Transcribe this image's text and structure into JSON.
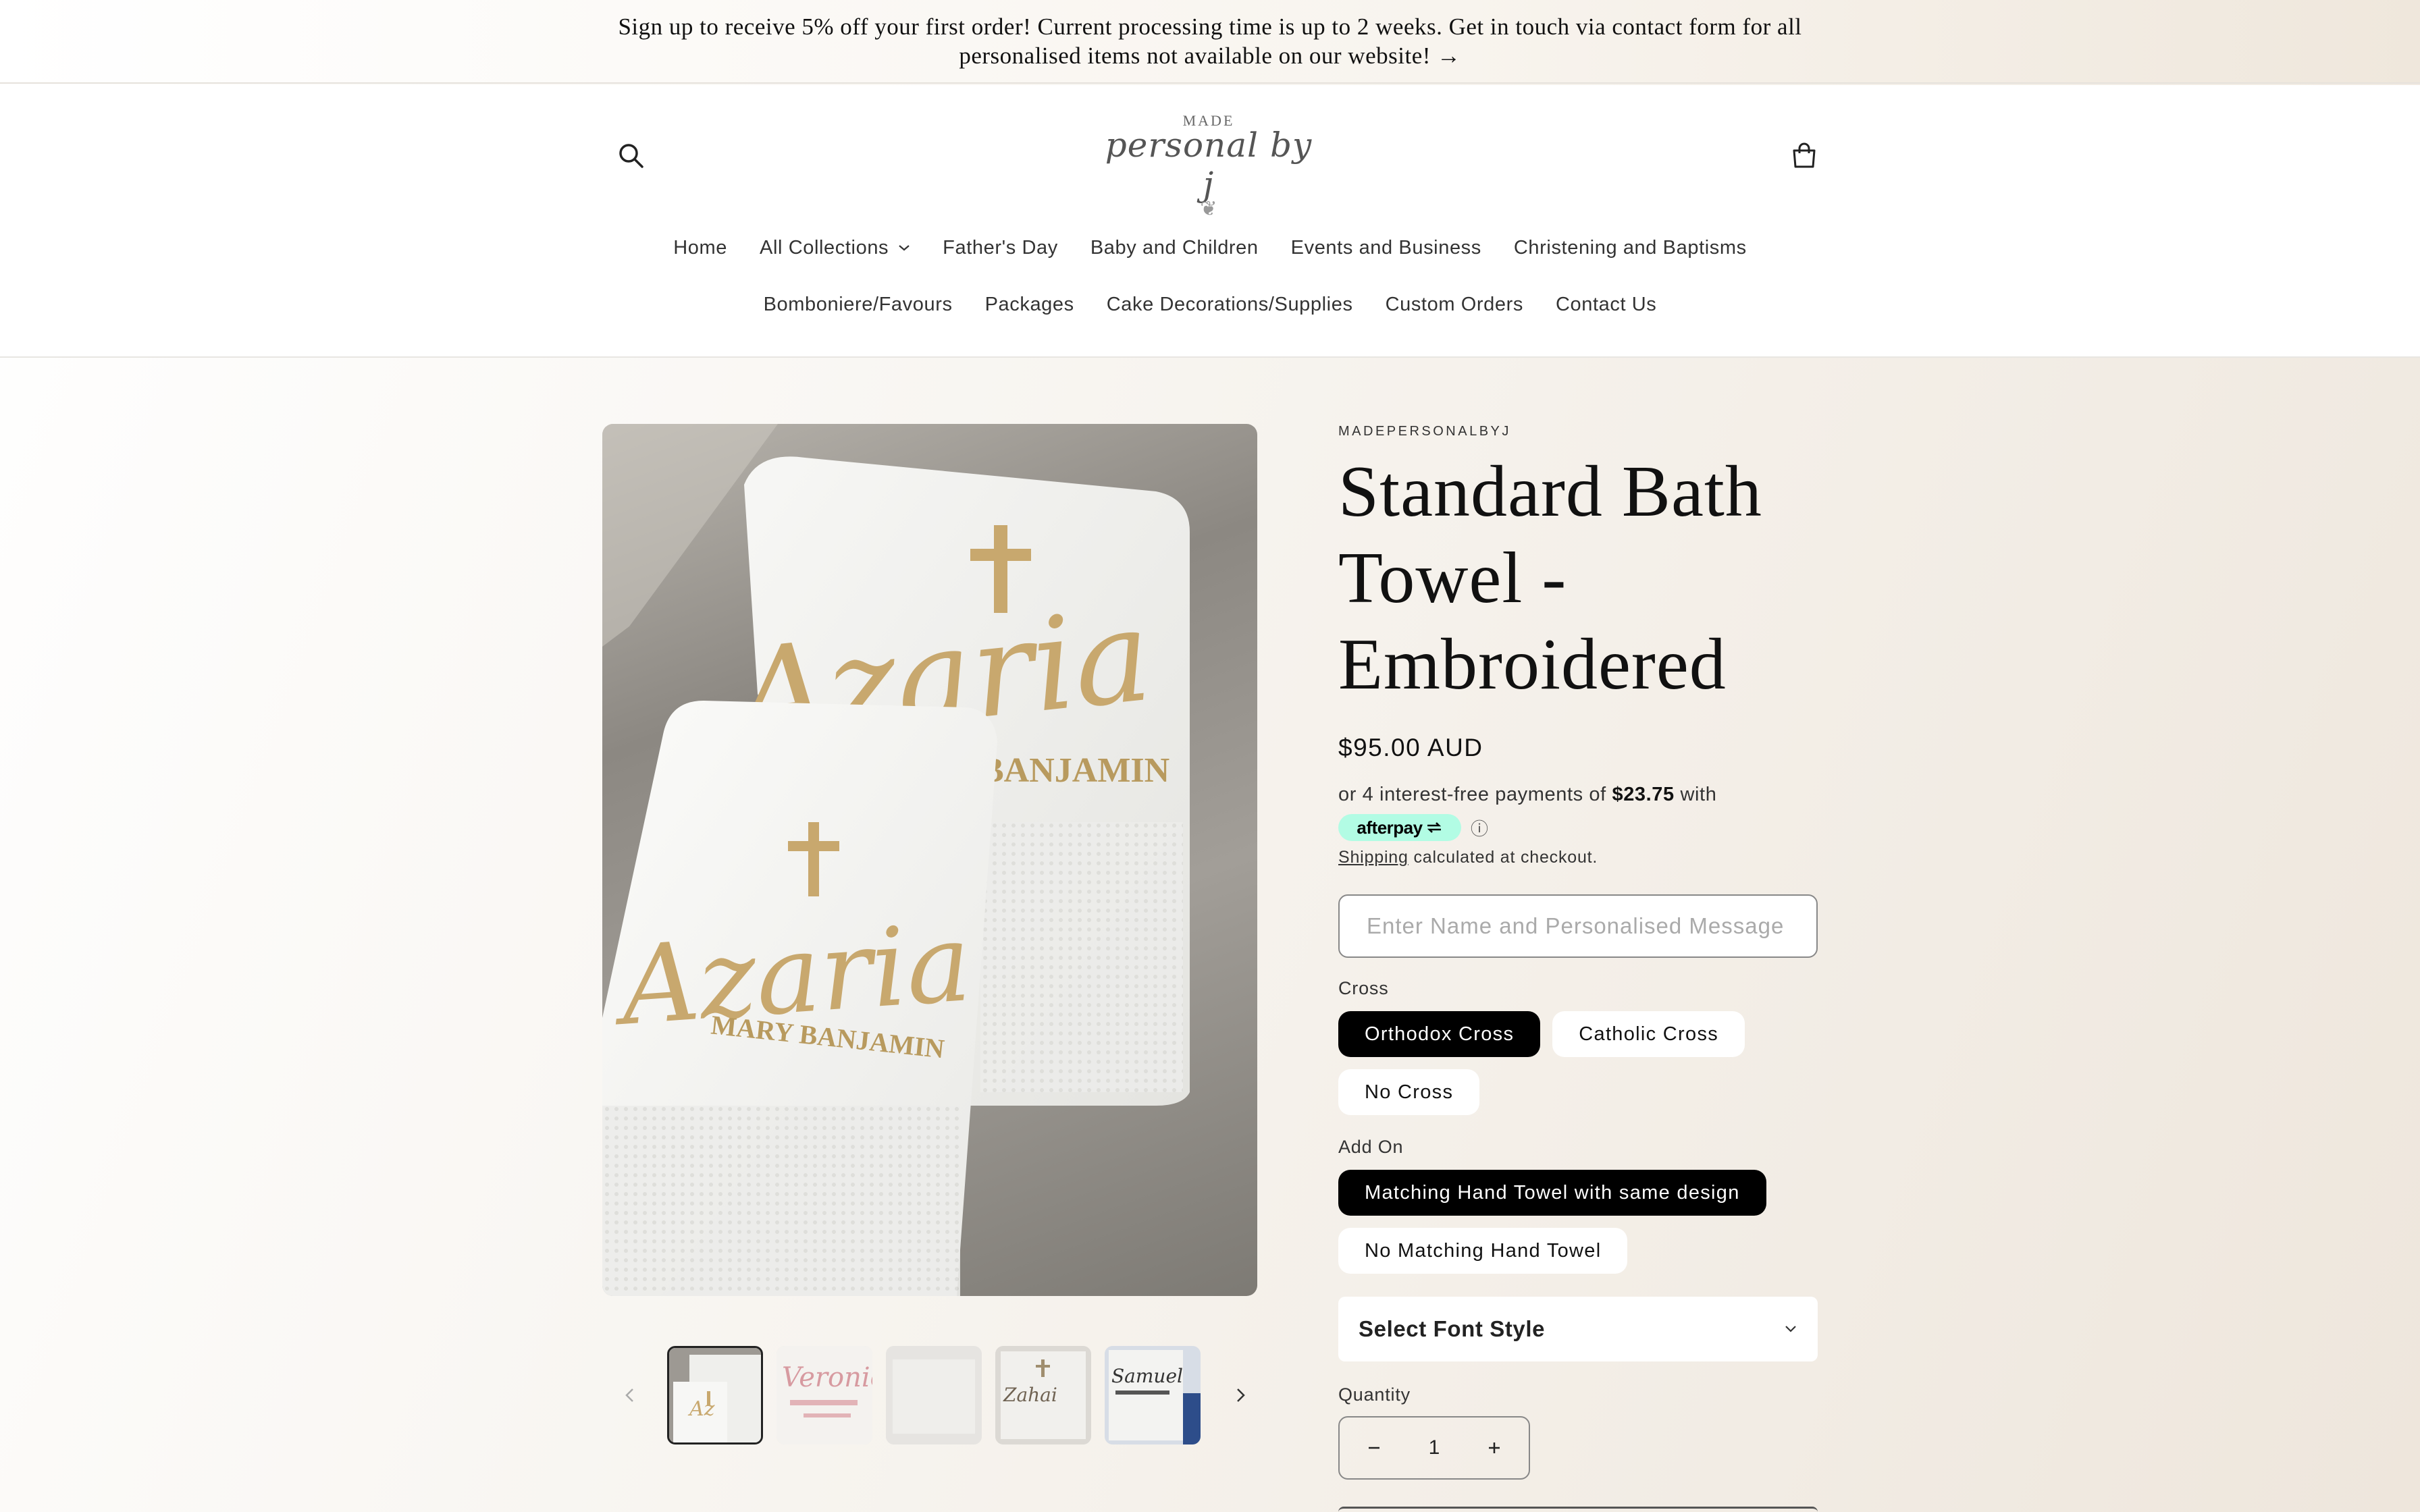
{
  "announcement": {
    "text": "Sign up to receive 5% off your first order! Current processing time is up to 2 weeks. Get in touch via contact form for all personalised items not available on our website! →"
  },
  "logo": {
    "top_text": "MADE",
    "script_text": "personal by j"
  },
  "nav": {
    "row1": [
      "Home",
      "All Collections",
      "Father's Day",
      "Baby and Children",
      "Events and Business",
      "Christening and Baptisms"
    ],
    "row2": [
      "Bomboniere/Favours",
      "Packages",
      "Cake Decorations/Supplies",
      "Custom Orders",
      "Contact Us"
    ]
  },
  "product": {
    "vendor": "MADEPERSONALBYJ",
    "title": "Standard Bath Towel - Embroidered",
    "price": "$95.00 AUD",
    "afterpay": {
      "prefix": "or 4 interest-free payments of",
      "amount": "$23.75",
      "suffix": "with",
      "badge": "afterpay"
    },
    "shipping": {
      "link": "Shipping",
      "text": "calculated at checkout."
    },
    "message_placeholder": "Enter Name and Personalised Message",
    "options": [
      {
        "label": "Cross",
        "values": [
          "Orthodox Cross",
          "Catholic Cross",
          "No Cross"
        ],
        "selected": "Orthodox Cross"
      },
      {
        "label": "Add On",
        "values": [
          "Matching Hand Towel with same design",
          "No Matching Hand Towel"
        ],
        "selected": "Matching Hand Towel with same design"
      }
    ],
    "font_select": "Select Font Style",
    "quantity_label": "Quantity",
    "quantity": "1"
  },
  "gallery": {
    "main_image": {
      "large_towel_name": "Azaria",
      "large_towel_subname": "BANJAMIN",
      "small_towel_name": "Azaria",
      "small_towel_subname": "MARY BANJAMIN"
    },
    "thumbnails": [
      {
        "text": "",
        "active": true
      },
      {
        "text": "Veronica",
        "active": false
      },
      {
        "text": "",
        "active": false
      },
      {
        "text": "Zahai",
        "active": false
      },
      {
        "text": "Samuel",
        "active": false
      }
    ]
  },
  "colors": {
    "accent": "#000000",
    "afterpay_mint": "#b2fce4",
    "embroidery_gold": "#c8a86e"
  }
}
